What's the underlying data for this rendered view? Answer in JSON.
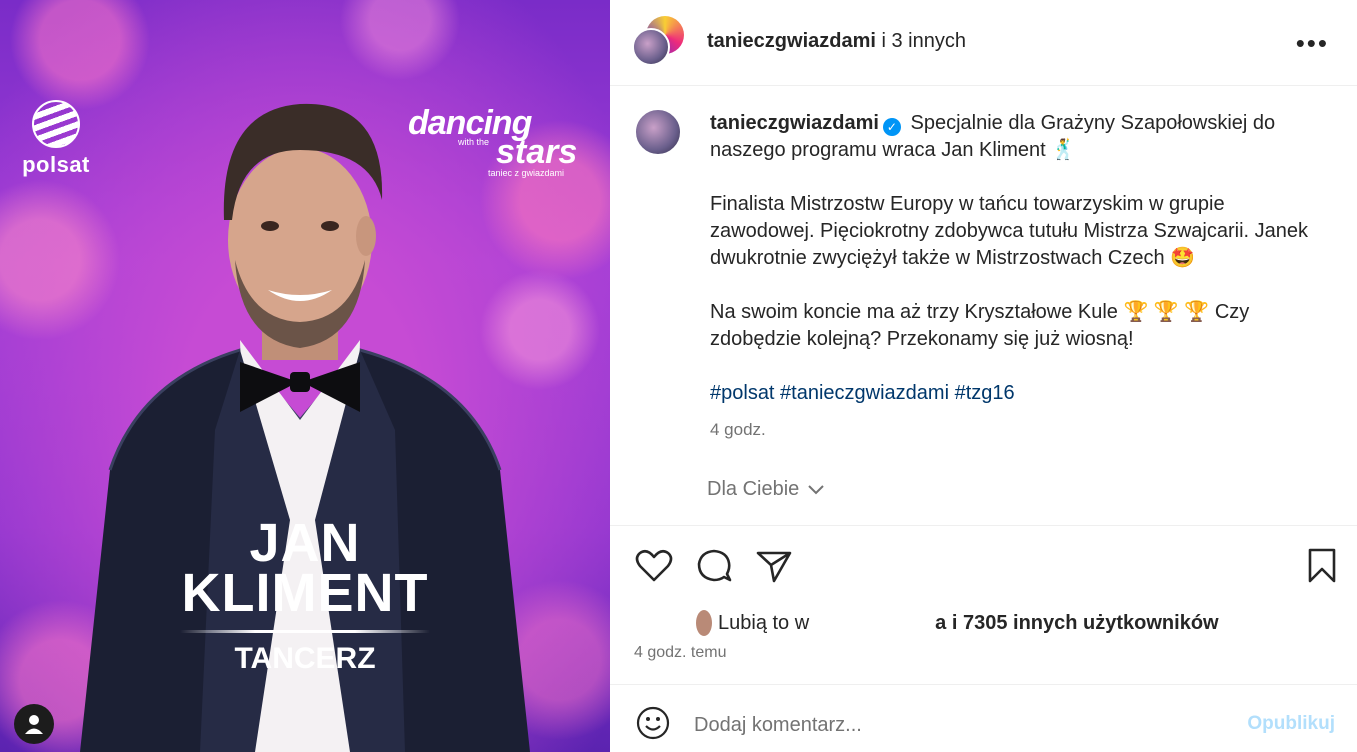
{
  "media": {
    "channel_logo": "polsat",
    "show_logo_line1": "dancing",
    "show_logo_line2": "with the",
    "show_logo_line3": "stars",
    "show_logo_line4": "taniec z gwiazdami",
    "name_first": "JAN",
    "name_last": "KLIMENT",
    "role": "TANCERZ",
    "profile_icon": "user-icon"
  },
  "header": {
    "username": "tanieczgwiazdami",
    "collab_suffix": " i 3 innych",
    "more_icon": "more-dots-icon"
  },
  "caption": {
    "username": "tanieczgwiazdami",
    "line1": "Specjalnie dla Grażyny Szapołowskiej do naszego programu wraca Jan Kliment 🕺",
    "line2": "Finalista Mistrzostw Europy w tańcu towarzyskim w grupie zawodowej. Pięciokrotny zdobywca tutułu Mistrza Szwajcarii. Janek dwukrotnie zwyciężył także w Mistrzostwach Czech 🤩",
    "line3": "Na swoim koncie ma aż trzy Kryształowe Kule 🏆 🏆 🏆  Czy zdobędzie kolejną? Przekonamy się już wiosną!",
    "hashtags": "#polsat #tanieczgwiazdami #tzg16",
    "time": "4 godz."
  },
  "for_you": {
    "label": "Dla Ciebie"
  },
  "actions": {
    "like_icon": "heart-icon",
    "comment_icon": "comment-icon",
    "share_icon": "share-icon",
    "save_icon": "bookmark-icon"
  },
  "likes": {
    "prefix": "Lubią to w",
    "suffix": "a i 7305 innych użytkowników"
  },
  "post_time": "4 godz. temu",
  "comment": {
    "placeholder": "Dodaj komentarz...",
    "post_label": "Opublikuj",
    "emoji_icon": "emoji-icon"
  },
  "colors": {
    "link": "#00376b",
    "muted": "#737373",
    "verified": "#0095f6",
    "post_disabled": "#b2dffc"
  }
}
